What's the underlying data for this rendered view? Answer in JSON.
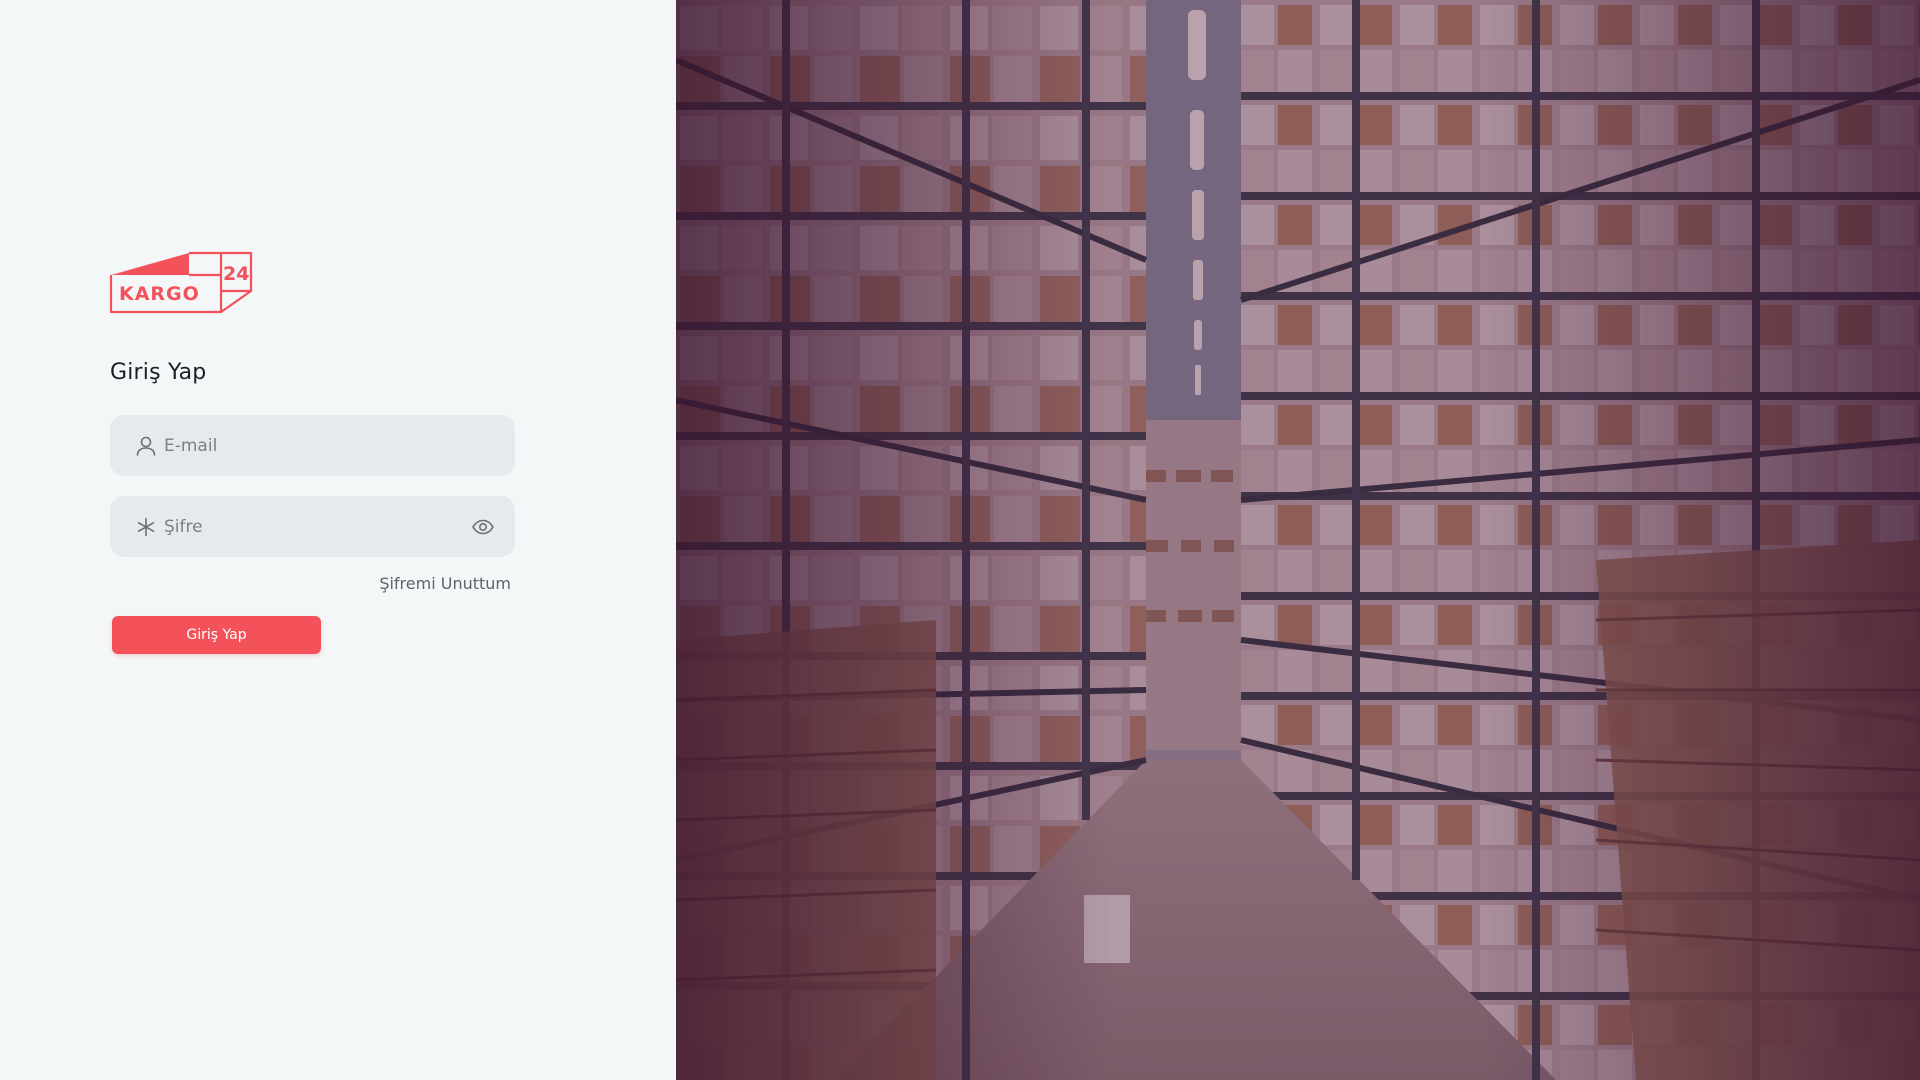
{
  "brand": {
    "logo_text": "KARGO",
    "logo_number": "24",
    "accent_color": "#f4525a"
  },
  "login": {
    "title": "Giriş Yap",
    "email_placeholder": "E-mail",
    "password_placeholder": "Şifre",
    "forgot_link": "Şifremi Unuttum",
    "submit_label": "Giriş Yap",
    "icons": {
      "email": "user-icon",
      "password": "asterisk-icon",
      "toggle": "eye-icon"
    }
  },
  "hero": {
    "image": "warehouse-aisle-photo",
    "overlay_color": "#4a1537"
  }
}
